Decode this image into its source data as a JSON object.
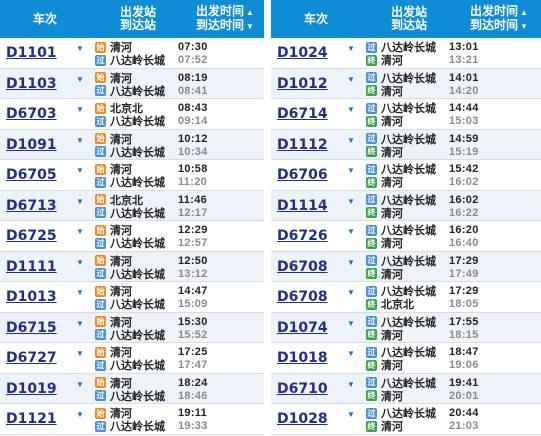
{
  "columns": {
    "train": "车次",
    "station_line1": "出发站",
    "station_line2": "到达站",
    "time_line1": "出发时间",
    "time_line2": "到达时间",
    "sort_up": "▲",
    "sort_down": "▼"
  },
  "icons": {
    "start_char": "始",
    "pass_char": "过",
    "end_char": "终",
    "caret": "▼"
  },
  "left_rows": [
    {
      "train": "D1101",
      "from": "清河",
      "to": "八达岭长城",
      "from_type": "start",
      "to_type": "pass",
      "dep": "07:30",
      "arr": "07:52"
    },
    {
      "train": "D1103",
      "from": "清河",
      "to": "八达岭长城",
      "from_type": "start",
      "to_type": "pass",
      "dep": "08:19",
      "arr": "08:41"
    },
    {
      "train": "D6703",
      "from": "北京北",
      "to": "八达岭长城",
      "from_type": "start",
      "to_type": "pass",
      "dep": "08:43",
      "arr": "09:14"
    },
    {
      "train": "D1091",
      "from": "清河",
      "to": "八达岭长城",
      "from_type": "start",
      "to_type": "pass",
      "dep": "10:12",
      "arr": "10:34"
    },
    {
      "train": "D6705",
      "from": "清河",
      "to": "八达岭长城",
      "from_type": "start",
      "to_type": "pass",
      "dep": "10:58",
      "arr": "11:20"
    },
    {
      "train": "D6713",
      "from": "北京北",
      "to": "八达岭长城",
      "from_type": "start",
      "to_type": "pass",
      "dep": "11:46",
      "arr": "12:17"
    },
    {
      "train": "D6725",
      "from": "清河",
      "to": "八达岭长城",
      "from_type": "start",
      "to_type": "pass",
      "dep": "12:29",
      "arr": "12:57"
    },
    {
      "train": "D1111",
      "from": "清河",
      "to": "八达岭长城",
      "from_type": "start",
      "to_type": "pass",
      "dep": "12:50",
      "arr": "13:12"
    },
    {
      "train": "D1013",
      "from": "清河",
      "to": "八达岭长城",
      "from_type": "start",
      "to_type": "pass",
      "dep": "14:47",
      "arr": "15:09"
    },
    {
      "train": "D6715",
      "from": "清河",
      "to": "八达岭长城",
      "from_type": "start",
      "to_type": "pass",
      "dep": "15:30",
      "arr": "15:52"
    },
    {
      "train": "D6727",
      "from": "清河",
      "to": "八达岭长城",
      "from_type": "start",
      "to_type": "pass",
      "dep": "17:25",
      "arr": "17:47"
    },
    {
      "train": "D1019",
      "from": "清河",
      "to": "八达岭长城",
      "from_type": "start",
      "to_type": "pass",
      "dep": "18:24",
      "arr": "18:46"
    },
    {
      "train": "D1121",
      "from": "清河",
      "to": "八达岭长城",
      "from_type": "start",
      "to_type": "pass",
      "dep": "19:11",
      "arr": "19:33"
    }
  ],
  "right_rows": [
    {
      "train": "D1024",
      "from": "八达岭长城",
      "to": "清河",
      "from_type": "pass",
      "to_type": "end",
      "dep": "13:01",
      "arr": "13:21"
    },
    {
      "train": "D1012",
      "from": "八达岭长城",
      "to": "清河",
      "from_type": "pass",
      "to_type": "end",
      "dep": "14:01",
      "arr": "14:20"
    },
    {
      "train": "D6714",
      "from": "八达岭长城",
      "to": "清河",
      "from_type": "pass",
      "to_type": "end",
      "dep": "14:44",
      "arr": "15:03"
    },
    {
      "train": "D1112",
      "from": "八达岭长城",
      "to": "清河",
      "from_type": "pass",
      "to_type": "end",
      "dep": "14:59",
      "arr": "15:19"
    },
    {
      "train": "D6706",
      "from": "八达岭长城",
      "to": "清河",
      "from_type": "pass",
      "to_type": "end",
      "dep": "15:42",
      "arr": "16:02"
    },
    {
      "train": "D1114",
      "from": "八达岭长城",
      "to": "清河",
      "from_type": "pass",
      "to_type": "end",
      "dep": "16:02",
      "arr": "16:22"
    },
    {
      "train": "D6726",
      "from": "八达岭长城",
      "to": "清河",
      "from_type": "pass",
      "to_type": "end",
      "dep": "16:20",
      "arr": "16:40"
    },
    {
      "train": "D6708",
      "from": "八达岭长城",
      "to": "清河",
      "from_type": "pass",
      "to_type": "end",
      "dep": "17:29",
      "arr": "17:49"
    },
    {
      "train": "D6708",
      "from": "八达岭长城",
      "to": "北京北",
      "from_type": "pass",
      "to_type": "end",
      "dep": "17:29",
      "arr": "18:05"
    },
    {
      "train": "D1074",
      "from": "八达岭长城",
      "to": "清河",
      "from_type": "pass",
      "to_type": "end",
      "dep": "17:55",
      "arr": "18:15"
    },
    {
      "train": "D1018",
      "from": "八达岭长城",
      "to": "清河",
      "from_type": "pass",
      "to_type": "end",
      "dep": "18:47",
      "arr": "19:06"
    },
    {
      "train": "D6710",
      "from": "八达岭长城",
      "to": "清河",
      "from_type": "pass",
      "to_type": "end",
      "dep": "19:41",
      "arr": "20:01"
    },
    {
      "train": "D1028",
      "from": "八达岭长城",
      "to": "清河",
      "from_type": "pass",
      "to_type": "end",
      "dep": "20:44",
      "arr": "21:03"
    }
  ]
}
